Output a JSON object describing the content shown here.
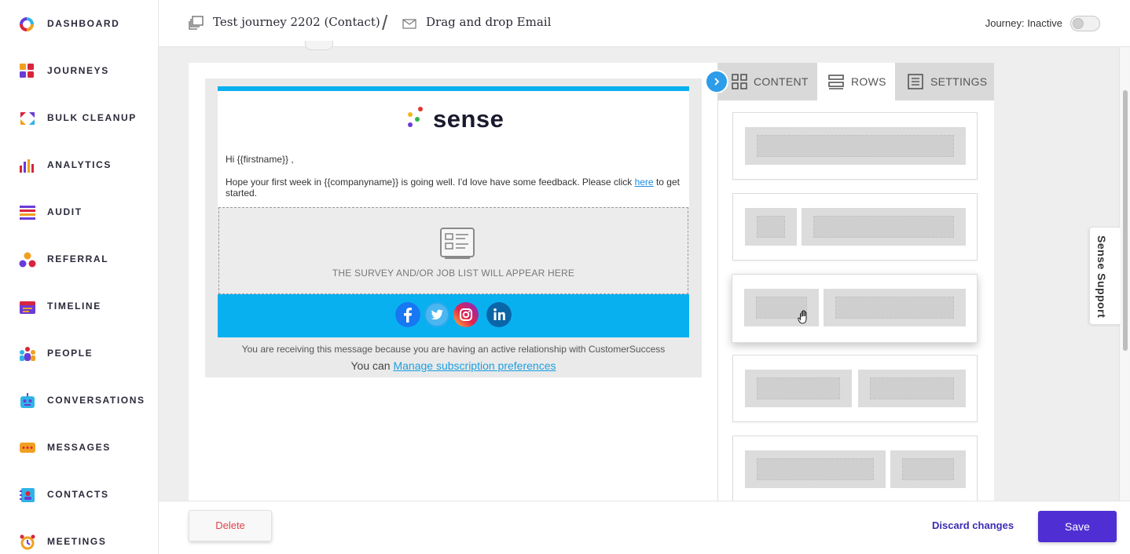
{
  "sidebar": {
    "items": [
      {
        "label": "DASHBOARD",
        "icon": "dashboard-ring-icon"
      },
      {
        "label": "JOURNEYS",
        "icon": "journeys-grid-icon"
      },
      {
        "label": "BULK CLEANUP",
        "icon": "bulk-cleanup-arrows-icon"
      },
      {
        "label": "ANALYTICS",
        "icon": "analytics-bars-icon"
      },
      {
        "label": "AUDIT",
        "icon": "audit-list-icon"
      },
      {
        "label": "REFERRAL",
        "icon": "referral-circles-icon"
      },
      {
        "label": "TIMELINE",
        "icon": "timeline-calendar-icon"
      },
      {
        "label": "PEOPLE",
        "icon": "people-group-icon"
      },
      {
        "label": "CONVERSATIONS",
        "icon": "conversations-robot-icon"
      },
      {
        "label": "MESSAGES",
        "icon": "messages-bubble-icon"
      },
      {
        "label": "CONTACTS",
        "icon": "contacts-card-icon"
      },
      {
        "label": "MEETINGS",
        "icon": "meetings-clock-icon"
      }
    ]
  },
  "header": {
    "journey_name": "Test journey 2202 (Contact)",
    "separator": "/",
    "page_name": "Drag and drop Email",
    "journey_status": "Journey: Inactive",
    "journey_active": false
  },
  "email": {
    "logo_text": "sense",
    "greeting": "Hi {{firstname}}  ,",
    "paragraph_before_link": "Hope your first week in {{companyname}}  is going well. I'd love have some feedback. Please click ",
    "link_text": "here",
    "paragraph_after_link": "  to get started.",
    "survey_placeholder": "THE SURVEY AND/OR JOB LIST WILL APPEAR HERE",
    "social": [
      "facebook",
      "twitter",
      "instagram",
      "linkedin"
    ],
    "footer_note": "You are receiving this message because you are having an active relationship with CustomerSuccess",
    "footer_manage_prefix": "You can ",
    "footer_manage_link": "Manage subscription preferences"
  },
  "panel": {
    "tabs": [
      {
        "label": "CONTENT",
        "active": false
      },
      {
        "label": "ROWS",
        "active": true
      },
      {
        "label": "SETTINGS",
        "active": false
      }
    ],
    "row_layouts": [
      "1 column",
      "1/4 + 3/4",
      "1/3 + 2/3",
      "1/2 + 1/2",
      "2/3 + 1/3"
    ]
  },
  "support": {
    "label": "Sense Support"
  },
  "footer": {
    "delete_label": "Delete",
    "discard_label": "Discard changes",
    "save_label": "Save"
  },
  "colors": {
    "accent_blue": "#09b0ef",
    "save_purple": "#4f2fd3",
    "delete_red": "#e0434b",
    "discard_indigo": "#3b2db5"
  }
}
